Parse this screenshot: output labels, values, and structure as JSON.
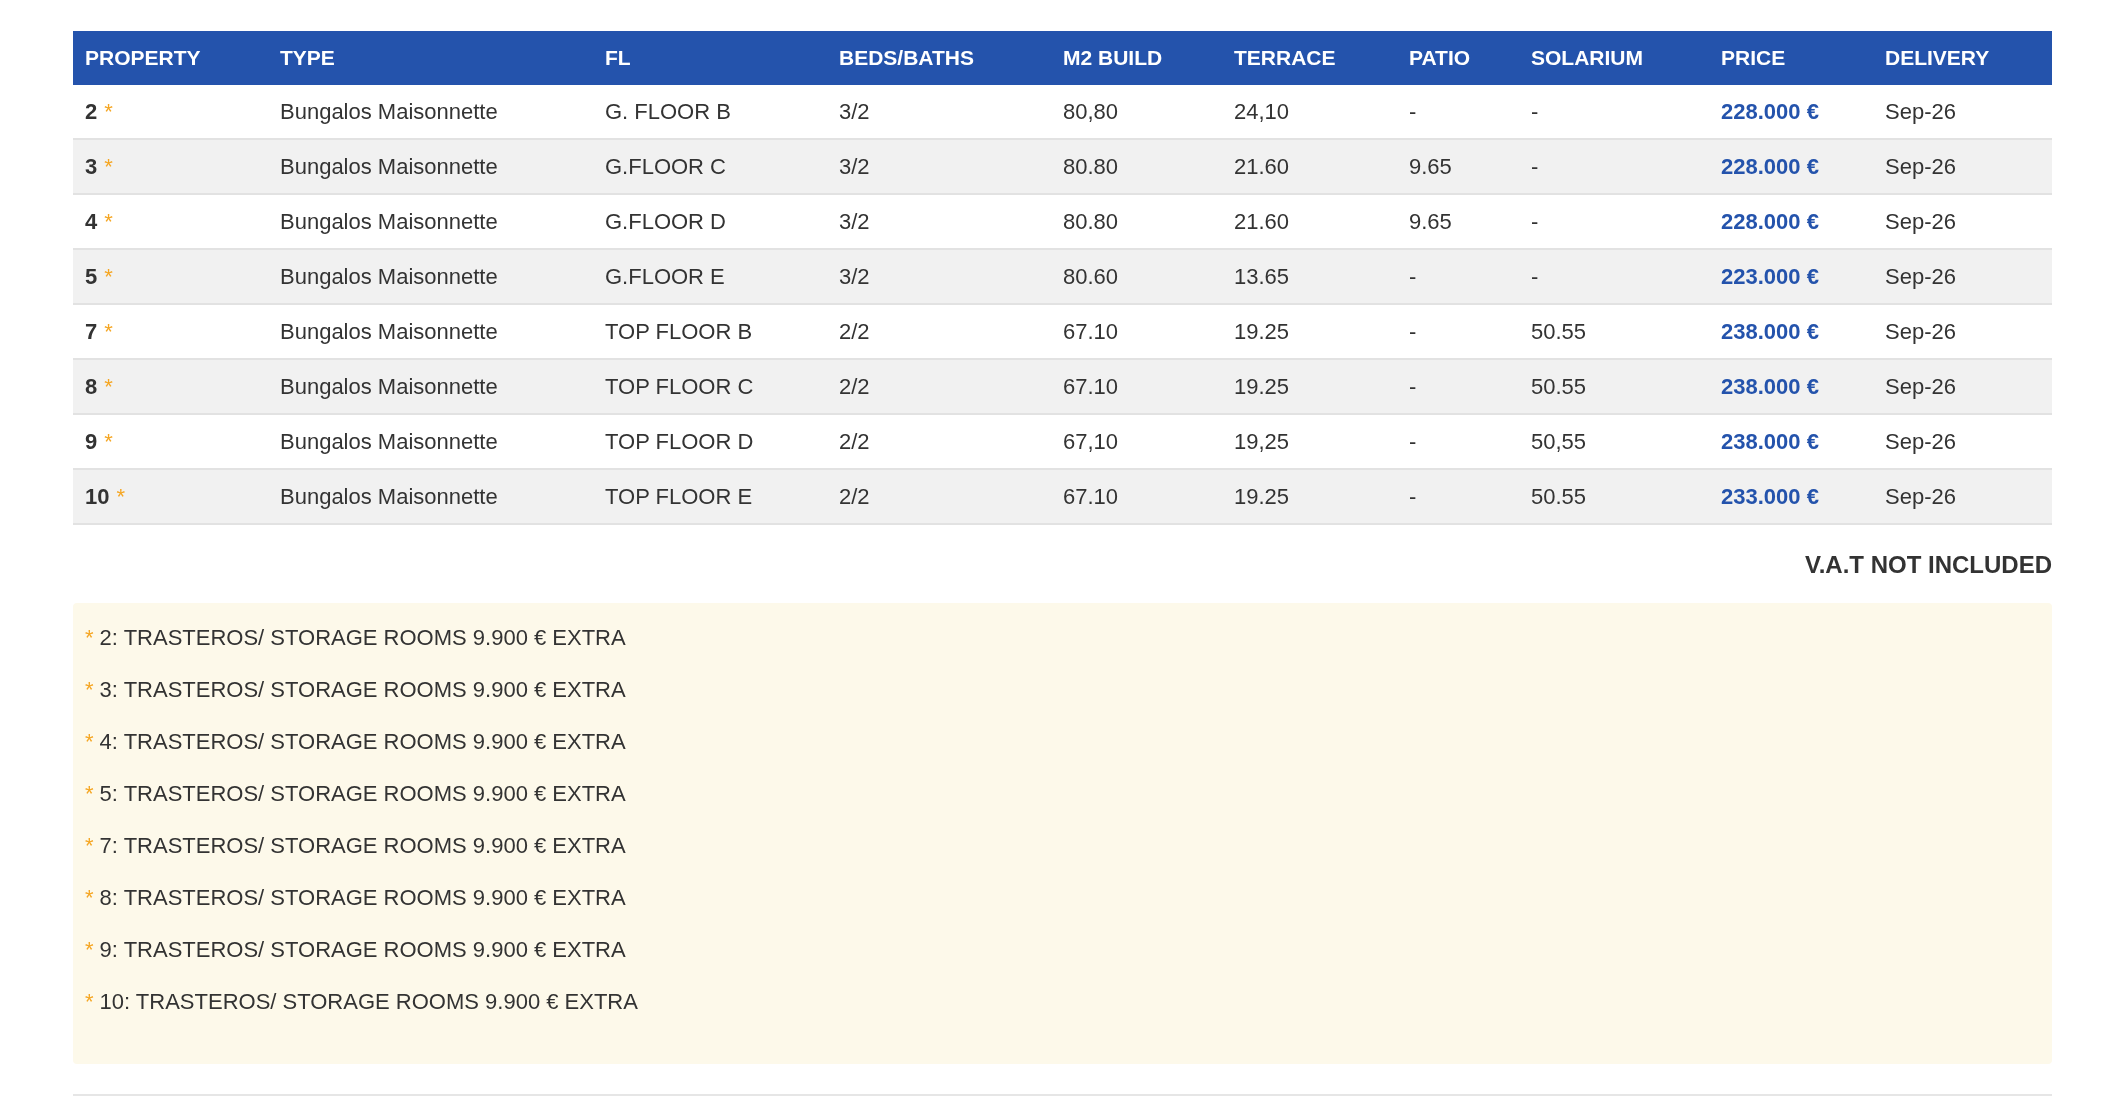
{
  "table": {
    "columns": [
      "PROPERTY",
      "TYPE",
      "FL",
      "BEDS/BATHS",
      "M2 BUILD",
      "TERRACE",
      "PATIO",
      "SOLARIUM",
      "PRICE",
      "DELIVERY"
    ],
    "rows": [
      {
        "property": "2",
        "mark": "*",
        "type": "Bungalos Maisonnette",
        "fl": "G. FLOOR B",
        "beds_baths": "3/2",
        "m2_build": "80,80",
        "terrace": "24,10",
        "patio": "-",
        "solarium": "-",
        "price": "228.000 €",
        "delivery": "Sep-26"
      },
      {
        "property": "3",
        "mark": "*",
        "type": "Bungalos Maisonnette",
        "fl": "G.FLOOR C",
        "beds_baths": "3/2",
        "m2_build": "80.80",
        "terrace": "21.60",
        "patio": "9.65",
        "solarium": "-",
        "price": "228.000 €",
        "delivery": "Sep-26"
      },
      {
        "property": "4",
        "mark": "*",
        "type": "Bungalos Maisonnette",
        "fl": "G.FLOOR D",
        "beds_baths": "3/2",
        "m2_build": "80.80",
        "terrace": "21.60",
        "patio": "9.65",
        "solarium": "-",
        "price": "228.000 €",
        "delivery": "Sep-26"
      },
      {
        "property": "5",
        "mark": "*",
        "type": "Bungalos Maisonnette",
        "fl": "G.FLOOR E",
        "beds_baths": "3/2",
        "m2_build": "80.60",
        "terrace": "13.65",
        "patio": "-",
        "solarium": "-",
        "price": "223.000 €",
        "delivery": "Sep-26"
      },
      {
        "property": "7",
        "mark": "*",
        "type": "Bungalos Maisonnette",
        "fl": "TOP FLOOR B",
        "beds_baths": "2/2",
        "m2_build": "67.10",
        "terrace": "19.25",
        "patio": "-",
        "solarium": "50.55",
        "price": "238.000 €",
        "delivery": "Sep-26"
      },
      {
        "property": "8",
        "mark": "*",
        "type": "Bungalos Maisonnette",
        "fl": "TOP FLOOR C",
        "beds_baths": "2/2",
        "m2_build": "67.10",
        "terrace": "19.25",
        "patio": "-",
        "solarium": "50.55",
        "price": "238.000 €",
        "delivery": "Sep-26"
      },
      {
        "property": "9",
        "mark": "*",
        "type": "Bungalos Maisonnette",
        "fl": "TOP FLOOR D",
        "beds_baths": "2/2",
        "m2_build": "67,10",
        "terrace": "19,25",
        "patio": "-",
        "solarium": "50,55",
        "price": "238.000 €",
        "delivery": "Sep-26"
      },
      {
        "property": "10",
        "mark": "*",
        "type": "Bungalos Maisonnette",
        "fl": "TOP FLOOR E",
        "beds_baths": "2/2",
        "m2_build": "67.10",
        "terrace": "19.25",
        "patio": "-",
        "solarium": "50.55",
        "price": "233.000 €",
        "delivery": "Sep-26"
      }
    ]
  },
  "vat_note": "V.A.T NOT INCLUDED",
  "footnotes": [
    {
      "mark": "*",
      "text": "2: TRASTEROS/ STORAGE ROOMS 9.900 € EXTRA"
    },
    {
      "mark": "*",
      "text": "3: TRASTEROS/ STORAGE ROOMS 9.900 € EXTRA"
    },
    {
      "mark": "*",
      "text": "4: TRASTEROS/ STORAGE ROOMS 9.900 € EXTRA"
    },
    {
      "mark": "*",
      "text": "5: TRASTEROS/ STORAGE ROOMS 9.900 € EXTRA"
    },
    {
      "mark": "*",
      "text": "7: TRASTEROS/ STORAGE ROOMS 9.900 € EXTRA"
    },
    {
      "mark": "*",
      "text": "8: TRASTEROS/ STORAGE ROOMS 9.900 € EXTRA"
    },
    {
      "mark": "*",
      "text": "9: TRASTEROS/ STORAGE ROOMS 9.900 € EXTRA"
    },
    {
      "mark": "*",
      "text": "10: TRASTEROS/ STORAGE ROOMS 9.900 € EXTRA"
    }
  ]
}
